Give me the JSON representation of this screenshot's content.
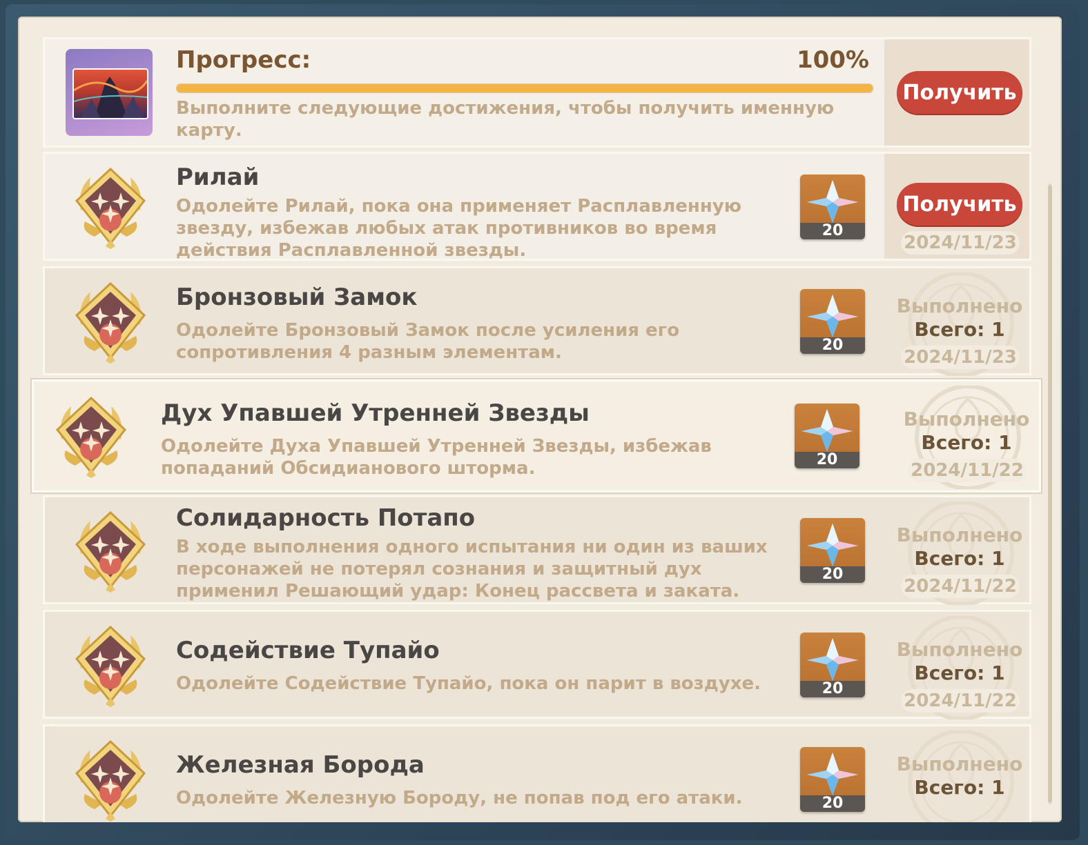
{
  "progress": {
    "title": "Прогресс:",
    "percent_text": "100%",
    "percent_value": 100,
    "description": "Выполните следующие достижения, чтобы получить именную карту.",
    "claim_label": "Получить"
  },
  "achievements": [
    {
      "title": "Рилай",
      "description": "Одолейте Рилай, пока она применяет Расплавленную звезду, избежав любых атак противников во время действия Расплавленной звезды.",
      "reward_count": "20",
      "status": "claim",
      "claim_label": "Получить",
      "date": "2024/11/23"
    },
    {
      "title": "Бронзовый Замок",
      "description": "Одолейте Бронзовый Замок после усиления его сопротивления 4 разным элементам.",
      "reward_count": "20",
      "status": "done",
      "done_label": "Выполнено",
      "total_label": "Всего: 1",
      "date": "2024/11/23"
    },
    {
      "title": "Дух Упавшей Утренней Звезды",
      "description": "Одолейте Духа Упавшей Утренней Звезды, избежав попаданий Обсидианового шторма.",
      "reward_count": "20",
      "status": "done",
      "done_label": "Выполнено",
      "total_label": "Всего: 1",
      "date": "2024/11/22"
    },
    {
      "title": "Солидарность Потапо",
      "description": "В ходе выполнения одного испытания ни один из ваших персонажей не потерял сознания и защитный дух применил Решающий удар: Конец рассвета и заката.",
      "reward_count": "20",
      "status": "done",
      "done_label": "Выполнено",
      "total_label": "Всего: 1",
      "date": "2024/11/22"
    },
    {
      "title": "Содействие Тупайо",
      "description": "Одолейте Содействие Тупайо, пока он парит в воздухе.",
      "reward_count": "20",
      "status": "done",
      "done_label": "Выполнено",
      "total_label": "Всего: 1",
      "date": "2024/11/22"
    },
    {
      "title": "Железная Борода",
      "description": "Одолейте Железную Бороду, не попав под его атаки.",
      "reward_count": "20",
      "status": "done",
      "done_label": "Выполнено",
      "total_label": "Всего: 1",
      "date": ""
    }
  ],
  "colors": {
    "accent_red": "#c8463a",
    "progress_fill": "#f3b444",
    "title_brown": "#7a5531"
  },
  "icons": {
    "medal": "achievement-medal-icon",
    "reward": "primogem-icon",
    "card": "namecard-icon",
    "stamp": "completed-stamp-icon"
  }
}
